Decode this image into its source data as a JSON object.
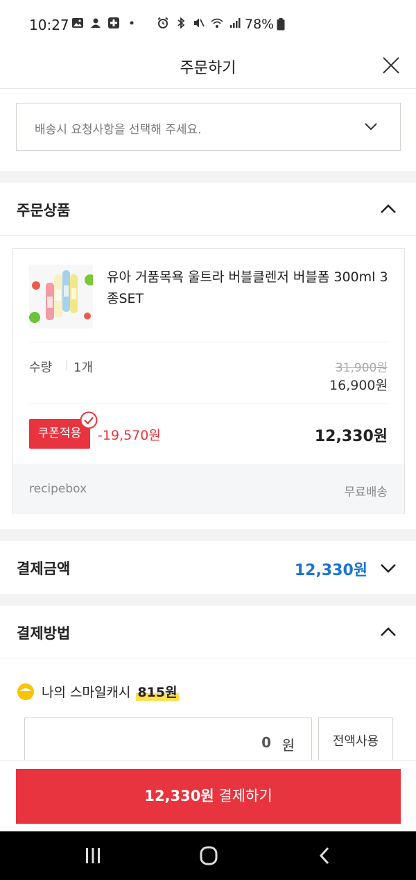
{
  "status_bar": {
    "time": "10:27",
    "battery": "78%"
  },
  "header": {
    "title": "주문하기"
  },
  "delivery": {
    "placeholder": "배송시 요청사항을 선택해 주세요."
  },
  "order_items": {
    "section_title": "주문상품",
    "product_name": "유아 거품목욕 울트라 버블클렌저 버블폼 300ml 3종SET",
    "quantity_label": "수량",
    "quantity_value": "1개",
    "original_price": "31,900원",
    "sale_price": "16,900원",
    "coupon_label": "쿠폰적용",
    "discount": "-19,570원",
    "final_price": "12,330원",
    "seller": "recipebox",
    "shipping": "무료배송"
  },
  "payment_amount": {
    "section_title": "결제금액",
    "amount": "12,330원"
  },
  "payment_method": {
    "section_title": "결제방법",
    "cash_label": "나의 스마일캐시",
    "cash_amount": "815원",
    "input_value": "0",
    "input_unit": "원",
    "use_all_label": "전액사용"
  },
  "pay_button": {
    "amount": "12,330원",
    "label": "결제하기"
  },
  "colors": {
    "accent_red": "#e8343e",
    "amount_blue": "#1a75d2",
    "highlight_yellow": "#ffe14d"
  }
}
